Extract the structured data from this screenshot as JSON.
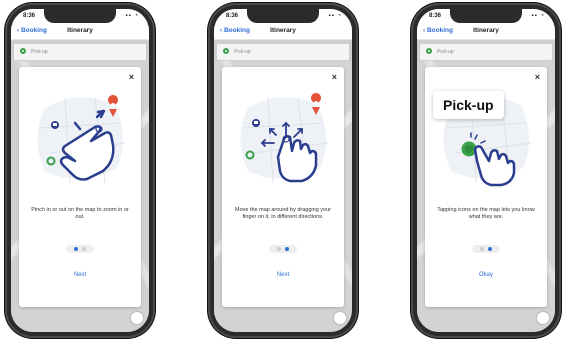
{
  "colors": {
    "accent": "#2f6fd6",
    "illustration_fill": "#eef1f5",
    "stroke": "#2a3d8f",
    "green": "#3aa14a",
    "red": "#e6533c"
  },
  "phones": [
    {
      "status_time": "8:36",
      "back_label": "Booking",
      "nav_title": "Itinerary",
      "pickup_label": "Pick-up",
      "gesture": "pinch-zoom-hand-icon",
      "caption": "Pinch in or out on the map to zoom in or out.",
      "action_label": "Next",
      "page_index": 0
    },
    {
      "status_time": "8:36",
      "back_label": "Booking",
      "nav_title": "Itinerary",
      "pickup_label": "Pick-up",
      "gesture": "drag-hand-icon",
      "caption": "Move the map around by dragging your finger on it, in different directions.",
      "action_label": "Next",
      "page_index": 1
    },
    {
      "status_time": "8:36",
      "back_label": "Booking",
      "nav_title": "Itinerary",
      "pickup_label": "Pick-up",
      "gesture": "tap-hand-icon",
      "tooltip": "Pick-up",
      "caption": "Tapping icons on the map lets you know what they are.",
      "action_label": "Okay",
      "page_index": 2
    }
  ]
}
